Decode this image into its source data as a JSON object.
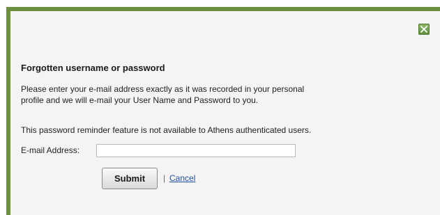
{
  "dialog": {
    "close_icon": "close-x-icon",
    "title": "Forgotten username or password",
    "intro_line1": "Please enter your e-mail address exactly as it was recorded in your personal",
    "intro_line2": "profile and we will e-mail your User Name and Password to you.",
    "notice": "This password reminder feature is not available to Athens authenticated users.",
    "email_label": "E-mail Address:",
    "email_value": "",
    "submit_label": "Submit",
    "separator": "|",
    "cancel_label": "Cancel"
  },
  "colors": {
    "accent_green": "#6b8f3e",
    "panel_bg": "#f4f4f4",
    "link_blue": "#1f4f9e"
  }
}
